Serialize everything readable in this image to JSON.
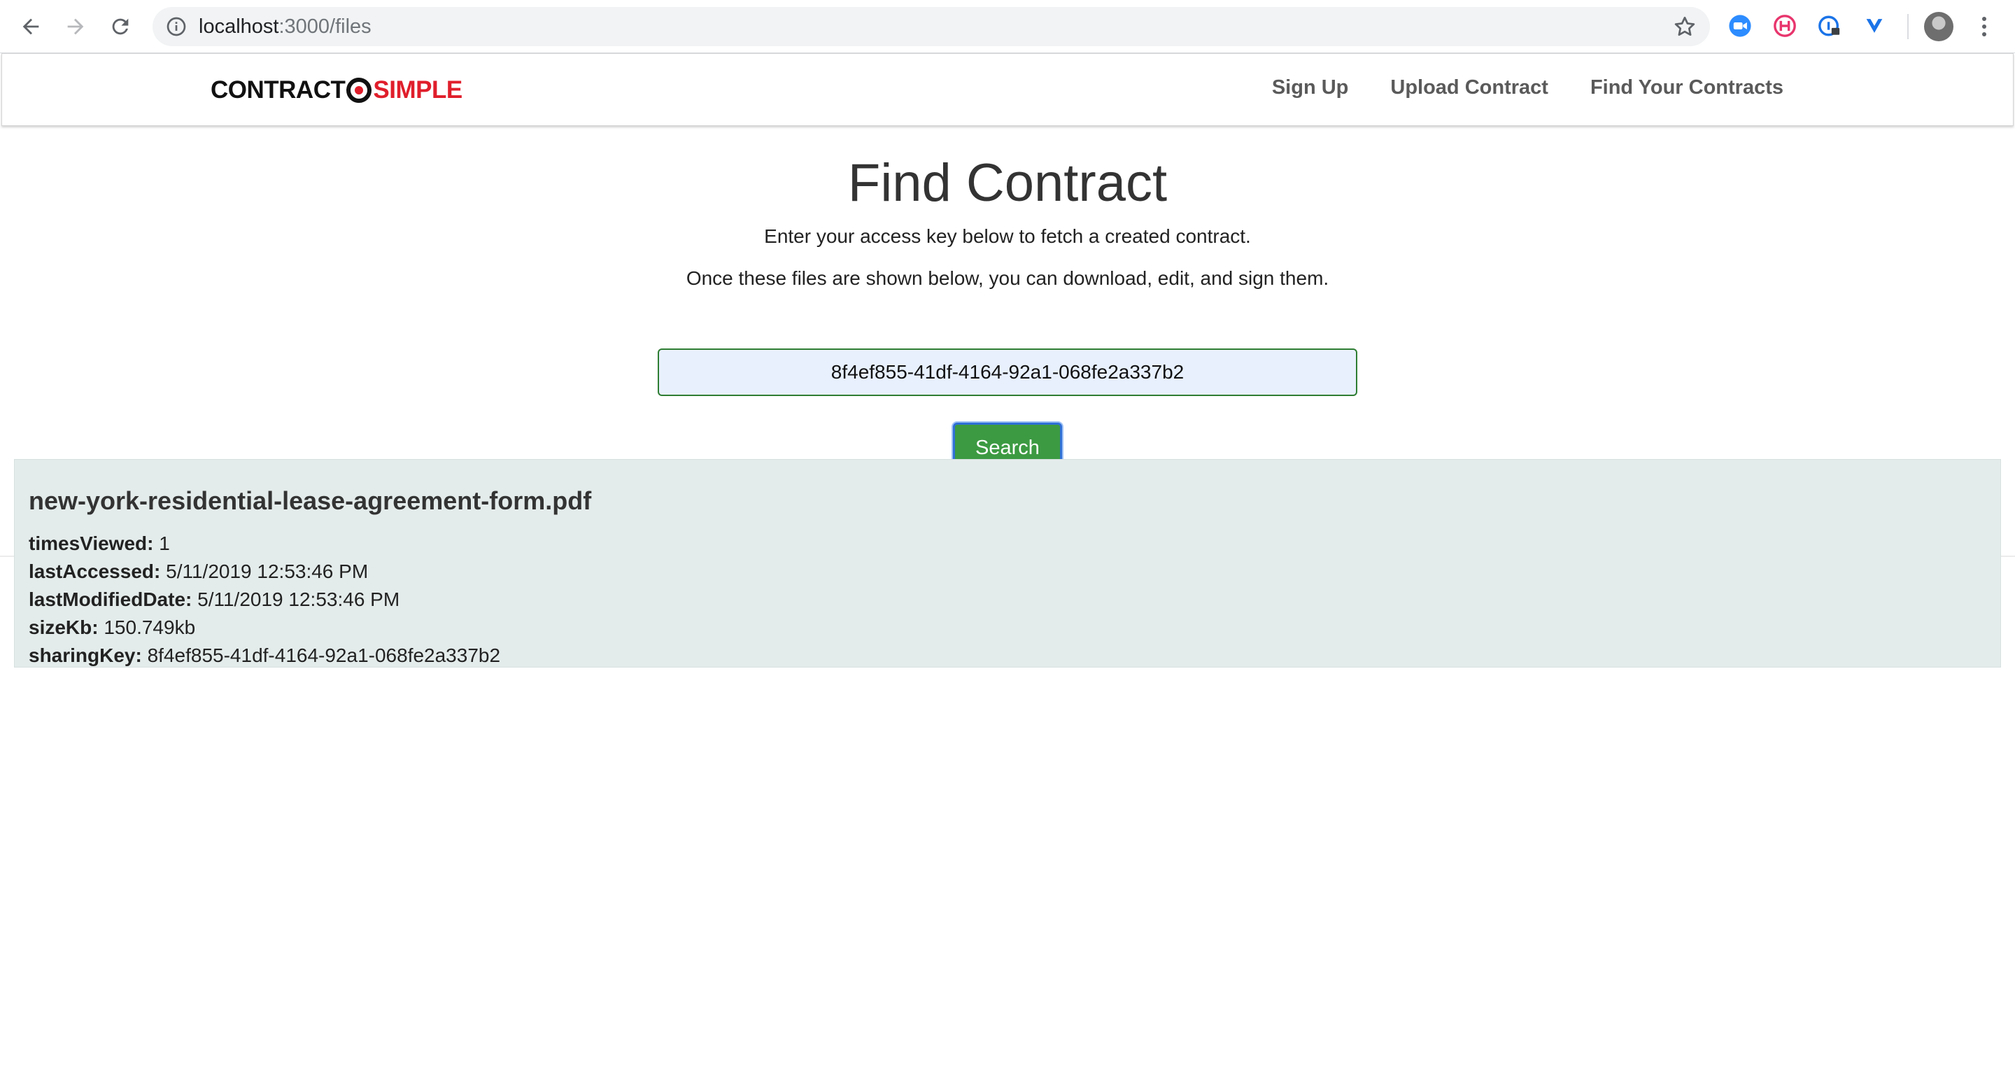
{
  "browser": {
    "url_host": "localhost",
    "url_path": ":3000/files",
    "nav": {
      "back": "back-arrow",
      "forward": "forward-arrow",
      "reload": "reload"
    },
    "extensions": [
      "zoom-ext-icon",
      "honey-ext-icon",
      "password-ext-icon",
      "vimeo-ext-icon"
    ]
  },
  "site": {
    "logo": {
      "part1": "CONTRACT",
      "part2": "SIMPLE"
    },
    "nav": [
      {
        "label": "Sign Up"
      },
      {
        "label": "Upload Contract"
      },
      {
        "label": "Find Your Contracts"
      }
    ]
  },
  "page": {
    "title": "Find Contract",
    "subtitle1": "Enter your access key below to fetch a created contract.",
    "subtitle2": "Once these files are shown below, you can download, edit, and sign them.",
    "search_value": "8f4ef855-41df-4164-92a1-068fe2a337b2",
    "search_button": "Search"
  },
  "result": {
    "filename": "new-york-residential-lease-agreement-form.pdf",
    "fields": [
      {
        "key": "timesViewed:",
        "value": "1"
      },
      {
        "key": "lastAccessed:",
        "value": "5/11/2019 12:53:46 PM"
      },
      {
        "key": "lastModifiedDate:",
        "value": "5/11/2019 12:53:46 PM"
      },
      {
        "key": "sizeKb:",
        "value": "150.749kb"
      },
      {
        "key": "sharingKey:",
        "value": "8f4ef855-41df-4164-92a1-068fe2a337b2"
      }
    ]
  },
  "colors": {
    "accent_green": "#3c9a42",
    "logo_red": "#e01e2b",
    "card_bg": "#e4eceb"
  }
}
